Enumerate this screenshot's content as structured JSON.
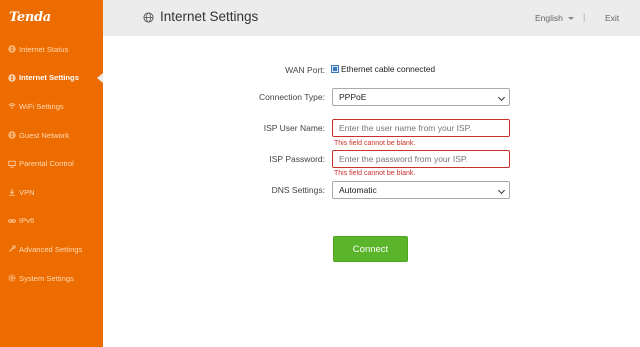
{
  "brand": {
    "logo_text": "Tenda"
  },
  "sidebar": {
    "items": [
      {
        "label": "Internet Status",
        "icon": "globe-icon",
        "active": false
      },
      {
        "label": "Internet Settings",
        "icon": "globe-icon",
        "active": true
      },
      {
        "label": "WiFi Settings",
        "icon": "wifi-icon",
        "active": false
      },
      {
        "label": "Guest Network",
        "icon": "globe-icon",
        "active": false
      },
      {
        "label": "Parental Control",
        "icon": "monitor-icon",
        "active": false
      },
      {
        "label": "VPN",
        "icon": "download-icon",
        "active": false
      },
      {
        "label": "IPv6",
        "icon": "link-icon",
        "active": false
      },
      {
        "label": "Advanced Settings",
        "icon": "tools-icon",
        "active": false
      },
      {
        "label": "System Settings",
        "icon": "gear-icon",
        "active": false
      }
    ]
  },
  "header": {
    "title": "Internet Settings",
    "language": "English",
    "separator": "|",
    "exit_label": "Exit"
  },
  "form": {
    "wan_port": {
      "label": "WAN Port:",
      "status": "Ethernet cable connected"
    },
    "connection_type": {
      "label": "Connection Type:",
      "value": "PPPoE"
    },
    "isp_user": {
      "label": "ISP User Name:",
      "placeholder": "Enter the user name from your ISP.",
      "error": "This field cannot be blank."
    },
    "isp_password": {
      "label": "ISP Password:",
      "placeholder": "Enter the password from your ISP.",
      "error": "This field cannot be blank."
    },
    "dns": {
      "label": "DNS Settings:",
      "value": "Automatic"
    },
    "connect_label": "Connect"
  },
  "colors": {
    "sidebar": "#ec6c00",
    "accent_green": "#5ab52a",
    "error_red": "#c9302c"
  }
}
